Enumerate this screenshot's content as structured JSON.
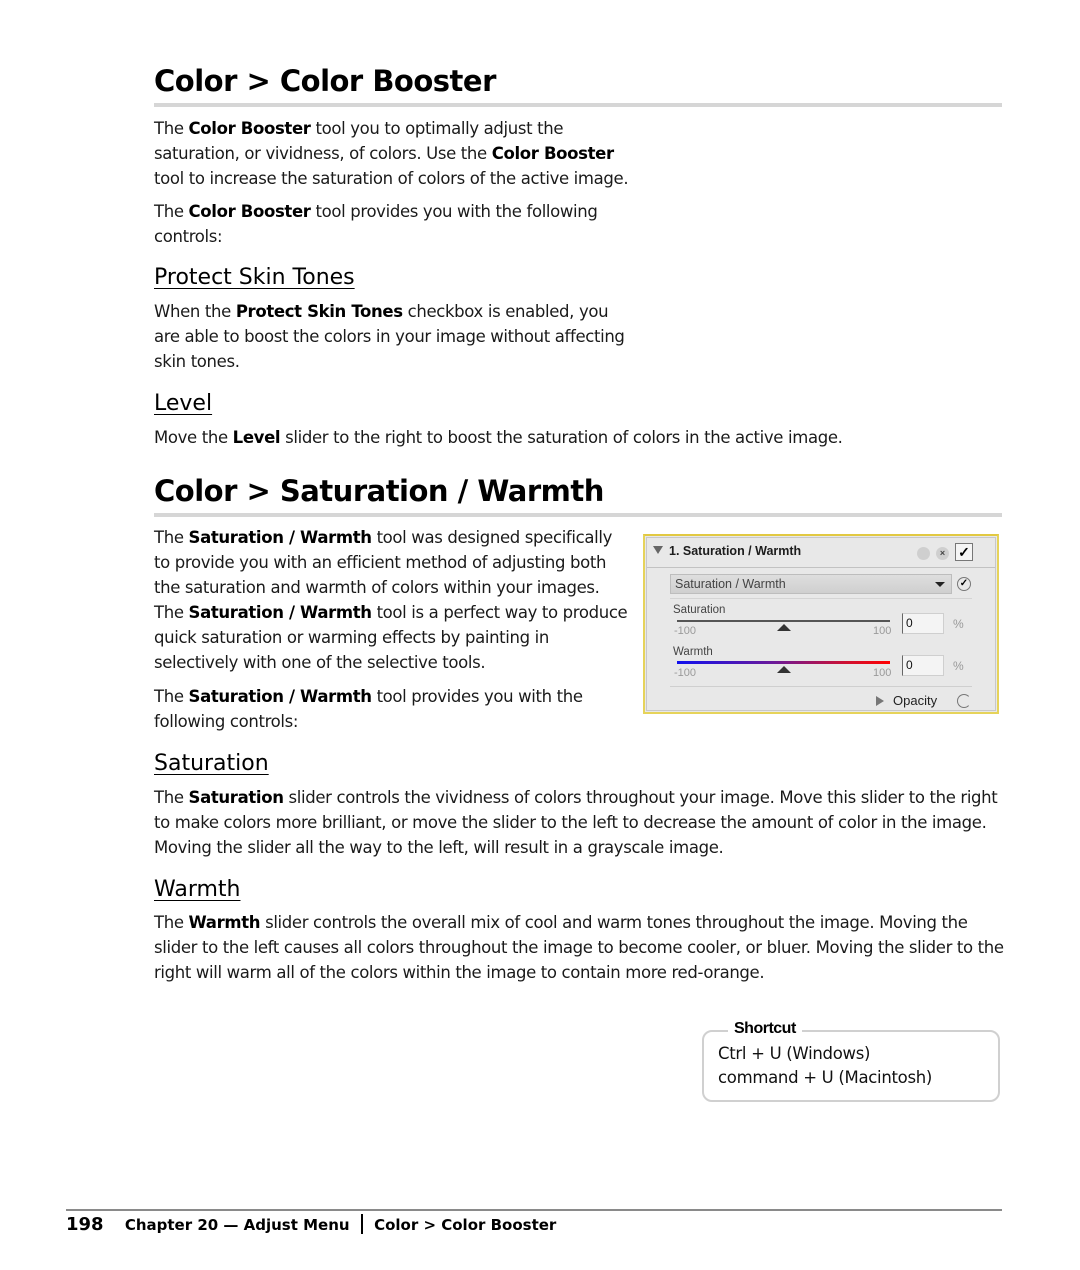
{
  "section1": {
    "title": "Color > Color Booster",
    "intro": {
      "p1": [
        "The ",
        "Color Booster",
        " tool you to optimally adjust the saturation, or vividness, of colors. Use the ",
        "Color Booster",
        " tool to increase the saturation of colors of the active image."
      ],
      "p2": [
        "The ",
        "Color Booster",
        " tool provides you with the following controls:"
      ]
    },
    "protect": {
      "heading": "Protect Skin Tones",
      "text": [
        "When the ",
        "Protect Skin Tones",
        " checkbox is enabled, you are able to boost the colors in your image without affecting skin tones."
      ]
    },
    "level": {
      "heading": "Level",
      "text": [
        "Move the ",
        "Level",
        " slider to the right to boost the saturation of colors in the active image."
      ]
    }
  },
  "section2": {
    "title": "Color > Saturation / Warmth",
    "intro": {
      "p1": [
        "The ",
        "Saturation / Warmth",
        " tool was designed specifically to provide you with an efficient method of adjusting both the saturation and warmth of colors within your images. The ",
        "Saturation / Warmth",
        " tool is a perfect way to produce quick saturation or warming effects by painting in selectively with one of the selective tools."
      ],
      "p2": [
        "The ",
        "Saturation / Warmth",
        " tool provides you with the following controls:"
      ]
    },
    "saturation": {
      "heading": "Saturation",
      "text": [
        "The ",
        "Saturation",
        " slider controls the vividness of colors throughout your image. Move this slider to the right to make colors more brilliant, or move the slider to the left to decrease the amount of color in the image. Moving the slider all the way to the left, will result in a grayscale image."
      ]
    },
    "warmth": {
      "heading": "Warmth",
      "text": [
        "The ",
        "Warmth",
        " slider controls the overall mix of cool and warm tones throughout the image. Moving the slider to the left causes all colors throughout the image to become cooler, or bluer. Moving the slider to the right will warm all of the colors within the image to contain more red-orange."
      ]
    }
  },
  "panel": {
    "title": "1. Saturation / Warmth",
    "checked": "✓",
    "dropdown_value": "Saturation / Warmth",
    "sliders": [
      {
        "label": "Saturation",
        "min": "-100",
        "max": "100",
        "value": "0",
        "unit": "%",
        "value_num": 0
      },
      {
        "label": "Warmth",
        "min": "-100",
        "max": "100",
        "value": "0",
        "unit": "%",
        "value_num": 0
      }
    ],
    "opacity_label": "Opacity",
    "icons": {
      "disclosure": "triangle-down-icon",
      "dot": "circle-icon",
      "close": "close-icon",
      "x_glyph": "×",
      "check": "check-icon",
      "round_check": "✓"
    }
  },
  "shortcut": {
    "title": "Shortcut",
    "lines": [
      "Ctrl + U (Windows)",
      "command + U (Macintosh)"
    ]
  },
  "footer": {
    "page_number": "198",
    "chapter": "Chapter 20 — Adjust Menu",
    "section": "Color > Color Booster"
  }
}
